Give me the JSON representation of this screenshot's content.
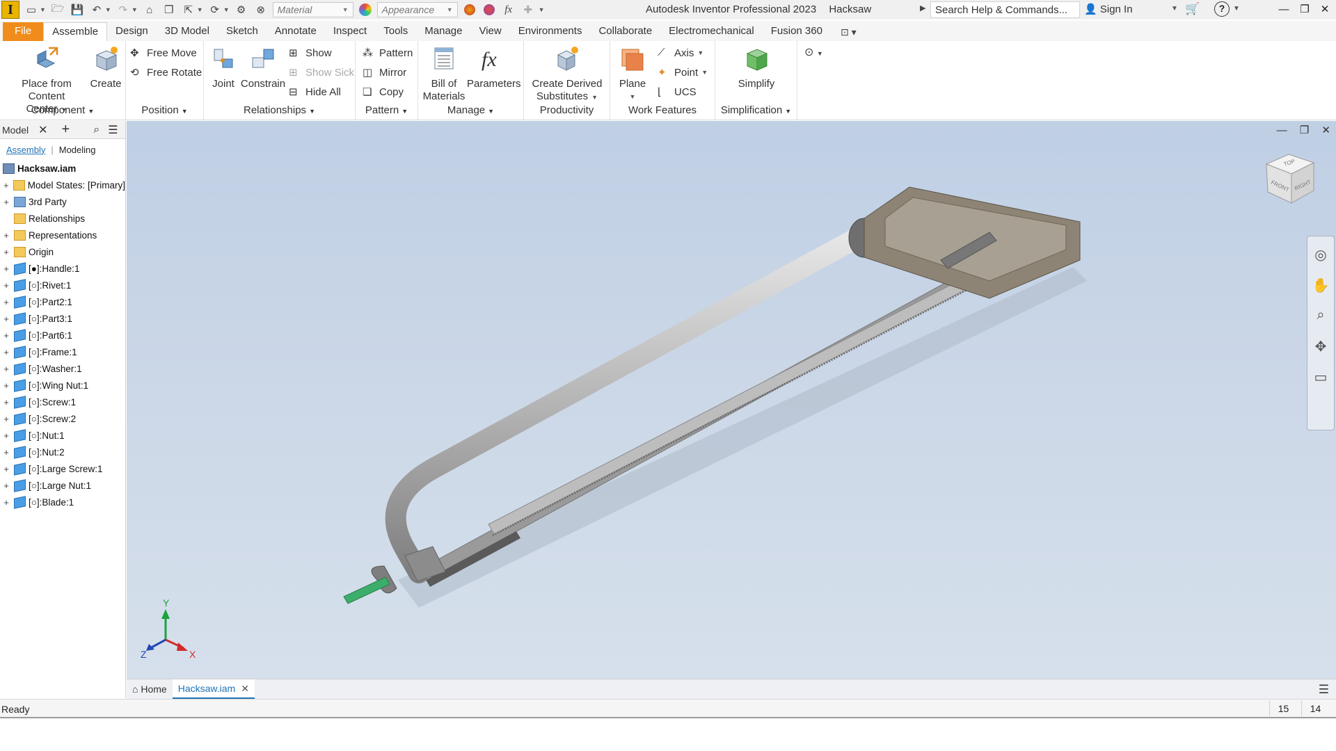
{
  "title_bar": {
    "app_name": "Autodesk Inventor Professional 2023",
    "document": "Hacksaw",
    "material_value": "Material",
    "appearance_value": "Appearance",
    "search_placeholder": "Search Help & Commands...",
    "sign_in": "Sign In",
    "help_symbol": "?"
  },
  "ribbon_tabs": [
    "File",
    "Assemble",
    "Design",
    "3D Model",
    "Sketch",
    "Annotate",
    "Inspect",
    "Tools",
    "Manage",
    "View",
    "Environments",
    "Collaborate",
    "Electromechanical",
    "Fusion 360"
  ],
  "active_tab": "Assemble",
  "ribbon": {
    "component": {
      "label": "Component",
      "place": "Place from",
      "place2": "Content Center",
      "create": "Create"
    },
    "position": {
      "label": "Position",
      "free_move": "Free Move",
      "free_rotate": "Free Rotate"
    },
    "relationships": {
      "label": "Relationships",
      "joint": "Joint",
      "constrain": "Constrain",
      "show": "Show",
      "show_sick": "Show Sick",
      "hide_all": "Hide All"
    },
    "pattern": {
      "label": "Pattern",
      "pattern": "Pattern",
      "mirror": "Mirror",
      "copy": "Copy"
    },
    "manage": {
      "label": "Manage",
      "bom": "Bill of",
      "bom2": "Materials",
      "parameters": "Parameters"
    },
    "productivity": {
      "label": "Productivity",
      "derived": "Create Derived",
      "derived2": "Substitutes"
    },
    "work_features": {
      "label": "Work Features",
      "plane": "Plane",
      "axis": "Axis",
      "point": "Point",
      "ucs": "UCS"
    },
    "simplification": {
      "label": "Simplification",
      "simplify": "Simplify"
    }
  },
  "browser": {
    "tab_title": "Model",
    "mode_assembly": "Assembly",
    "mode_modeling": "Modeling",
    "root": "Hacksaw.iam",
    "items": [
      {
        "label": "Model States: [Primary]",
        "icon": "folder"
      },
      {
        "label": "3rd Party",
        "icon": "3rd"
      },
      {
        "label": "Relationships",
        "icon": "folder"
      },
      {
        "label": "Representations",
        "icon": "folder"
      },
      {
        "label": "Origin",
        "icon": "folder"
      },
      {
        "label": "[●]:Handle:1",
        "icon": "part"
      },
      {
        "label": "[○]:Rivet:1",
        "icon": "part"
      },
      {
        "label": "[○]:Part2:1",
        "icon": "part"
      },
      {
        "label": "[○]:Part3:1",
        "icon": "part"
      },
      {
        "label": "[○]:Part6:1",
        "icon": "part"
      },
      {
        "label": "[○]:Frame:1",
        "icon": "part"
      },
      {
        "label": "[○]:Washer:1",
        "icon": "part"
      },
      {
        "label": "[○]:Wing Nut:1",
        "icon": "part"
      },
      {
        "label": "[○]:Screw:1",
        "icon": "part"
      },
      {
        "label": "[○]:Screw:2",
        "icon": "part"
      },
      {
        "label": "[○]:Nut:1",
        "icon": "part"
      },
      {
        "label": "[○]:Nut:2",
        "icon": "part"
      },
      {
        "label": "[○]:Large Screw:1",
        "icon": "part"
      },
      {
        "label": "[○]:Large Nut:1",
        "icon": "part"
      },
      {
        "label": "[○]:Blade:1",
        "icon": "part"
      }
    ]
  },
  "viewcube": {
    "top": "TOP",
    "front": "FRONT",
    "right": "RIGHT"
  },
  "triad": {
    "x": "X",
    "y": "Y",
    "z": "Z"
  },
  "doc_tabs": {
    "home": "Home",
    "active": "Hacksaw.iam"
  },
  "status": {
    "text": "Ready",
    "num1": "15",
    "num2": "14"
  }
}
